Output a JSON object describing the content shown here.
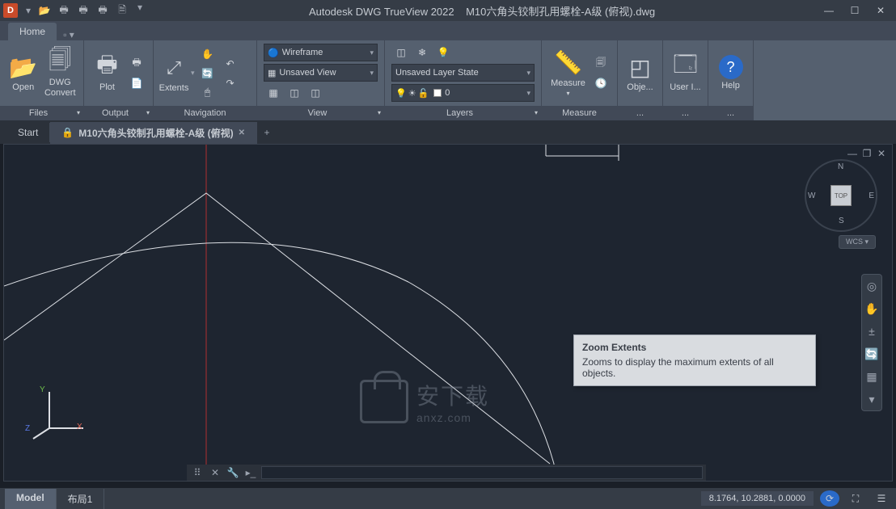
{
  "title": {
    "app": "Autodesk DWG TrueView 2022",
    "file": "M10六角头铰制孔用螺栓-A级 (俯视).dwg"
  },
  "ribbon": {
    "home": "Home",
    "panels": {
      "files": {
        "label": "Files",
        "open": "Open",
        "convert": "DWG\nConvert"
      },
      "output": {
        "label": "Output",
        "plot": "Plot"
      },
      "navigation": {
        "label": "Navigation",
        "extents": "Extents"
      },
      "view": {
        "label": "View",
        "wireframe": "Wireframe",
        "unsaved_view": "Unsaved View"
      },
      "layers": {
        "label": "Layers",
        "state": "Unsaved Layer State",
        "current": "0"
      },
      "measure": {
        "label": "Measure",
        "measure": "Measure"
      },
      "object": {
        "label": "...",
        "obj": "Obje..."
      },
      "user": {
        "label": "...",
        "user": "User I..."
      },
      "help": {
        "label": "...",
        "help": "Help"
      }
    }
  },
  "docs": {
    "start": "Start",
    "active": "M10六角头铰制孔用螺栓-A级 (俯视)"
  },
  "viewcube": {
    "top": "TOP",
    "n": "N",
    "s": "S",
    "e": "E",
    "w": "W",
    "wcs": "WCS"
  },
  "tooltip": {
    "title": "Zoom Extents",
    "body": "Zooms to display the maximum extents of all objects."
  },
  "ucs": {
    "x": "X",
    "y": "Y",
    "z": "Z"
  },
  "layouts": {
    "model": "Model",
    "layout1": "布局1"
  },
  "status": {
    "coords": "8.1764, 10.2881, 0.0000"
  },
  "watermark": {
    "cn": "安下载",
    "url": "anxz.com"
  }
}
